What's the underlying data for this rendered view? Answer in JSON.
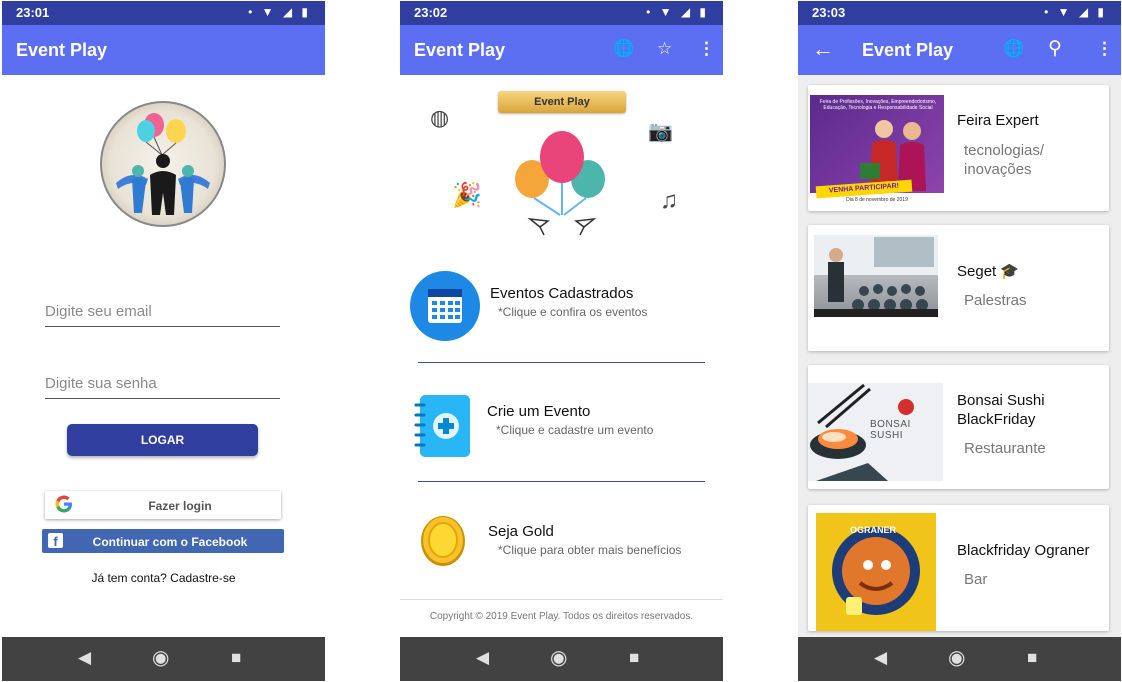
{
  "login_screen": {
    "status_time": "23:01",
    "app_title": "Event Play",
    "email_placeholder": "Digite seu email",
    "password_placeholder": "Digite sua senha",
    "login_button": "LOGAR",
    "google_button": "Fazer login",
    "facebook_button": "Continuar com o Facebook",
    "signup_link": "Já tem conta? Cadastre-se"
  },
  "home_screen": {
    "status_time": "23:02",
    "app_title": "Event Play",
    "banner": "Event Play",
    "items": [
      {
        "title": "Eventos Cadastrados",
        "subtitle": "*Clique e confira os eventos",
        "icon": "calendar-icon"
      },
      {
        "title": "Crie um Evento",
        "subtitle": "*Clique e cadastre um evento",
        "icon": "add-notebook-icon"
      },
      {
        "title": "Seja Gold",
        "subtitle": "*Clique para obter mais benefícios",
        "icon": "gold-coin-icon"
      }
    ],
    "copyright": "Copyright © 2019 Event Play. Todos os direitos reservados."
  },
  "events_screen": {
    "status_time": "23:03",
    "app_title": "Event Play",
    "events": [
      {
        "title": "Feira Expert",
        "subtitle": "tecnologias/\ninovações",
        "thumb_text_top": "Feira de Profissões, Inovações, Empreendedorismo, Educação, Tecnologia e Responsabilidade Social",
        "thumb_badge": "VENHA PARTICIPAR!",
        "thumb_date": "Dia 8 de novembro de 2019"
      },
      {
        "title": "Seget 🎓",
        "subtitle": "Palestras"
      },
      {
        "title": "Bonsai Sushi BlackFriday",
        "subtitle": "Restaurante",
        "thumb_brand": "BONSAI SUSHI"
      },
      {
        "title": "Blackfriday Ograner",
        "subtitle": "Bar",
        "thumb_brand": "OGRANER"
      }
    ]
  },
  "colors": {
    "app_bar": "#5c6ef2",
    "status_bar": "#303f9f",
    "primary_button": "#303f9f",
    "facebook": "#4267b2",
    "nav_bar": "#424242"
  }
}
